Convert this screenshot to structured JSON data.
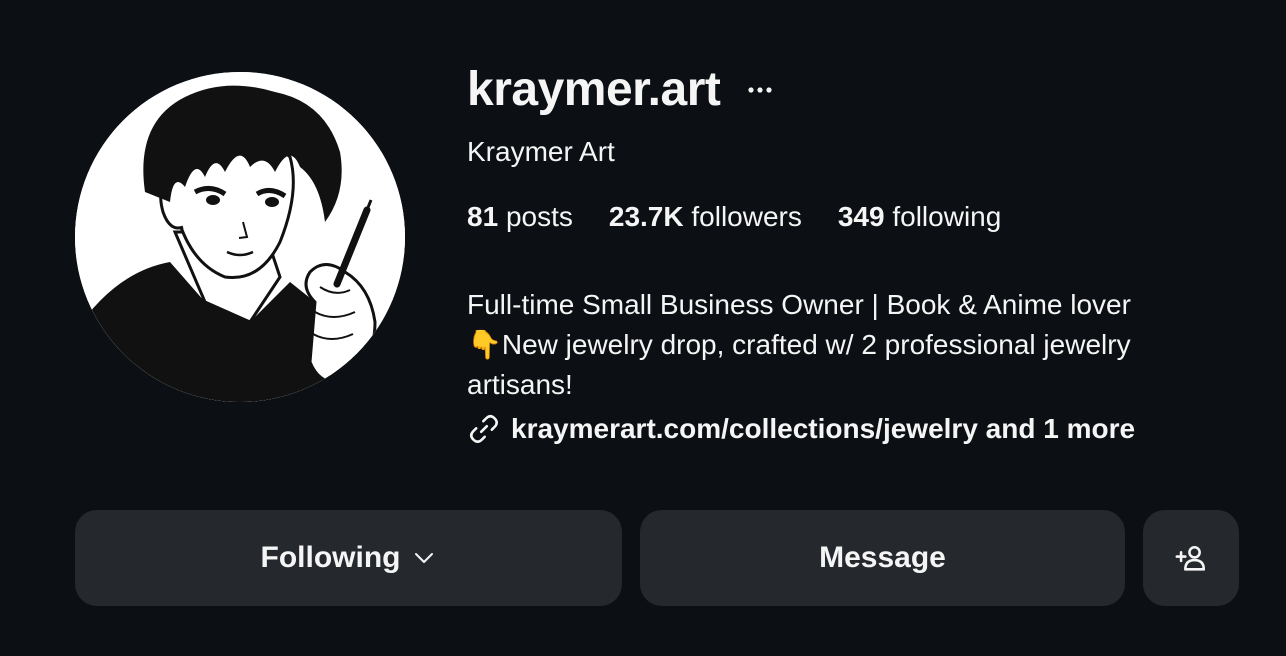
{
  "profile": {
    "username": "kraymer.art",
    "full_name": "Kraymer Art",
    "stats": [
      {
        "count": "81",
        "label": "posts"
      },
      {
        "count": "23.7K",
        "label": "followers"
      },
      {
        "count": "349",
        "label": "following"
      }
    ],
    "bio_lines": [
      "Full-time Small Business Owner | Book & Anime lover",
      "👇New jewelry drop, crafted w/ 2 professional jewelry",
      "artisans!"
    ],
    "link_text": "kraymerart.com/collections/jewelry and 1 more",
    "avatar_icon": "anime-artist-portrait",
    "more_icon": "ellipsis-icon",
    "link_icon": "link-icon"
  },
  "actions": {
    "following_label": "Following",
    "message_label": "Message",
    "add_user_icon": "add-user-icon"
  },
  "colors": {
    "background": "#0c1014",
    "button_bg": "#25282d",
    "text": "#f5f5f5"
  }
}
